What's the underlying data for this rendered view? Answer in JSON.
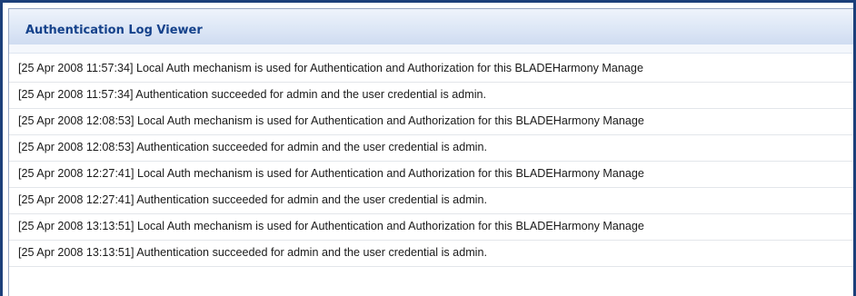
{
  "panel": {
    "title": "Authentication Log Viewer"
  },
  "log_entries": [
    "[25 Apr 2008 11:57:34] Local Auth mechanism is used for Authentication and Authorization for this BLADEHarmony Manage",
    "[25 Apr 2008 11:57:34] Authentication succeeded for admin and the user credential is admin.",
    "[25 Apr 2008 12:08:53] Local Auth mechanism is used for Authentication and Authorization for this BLADEHarmony Manage",
    "[25 Apr 2008 12:08:53] Authentication succeeded for admin and the user credential is admin.",
    "[25 Apr 2008 12:27:41] Local Auth mechanism is used for Authentication and Authorization for this BLADEHarmony Manage",
    "[25 Apr 2008 12:27:41] Authentication succeeded for admin and the user credential is admin.",
    "[25 Apr 2008 13:13:51] Local Auth mechanism is used for Authentication and Authorization for this BLADEHarmony Manage",
    "[25 Apr 2008 13:13:51] Authentication succeeded for admin and the user credential is admin."
  ]
}
